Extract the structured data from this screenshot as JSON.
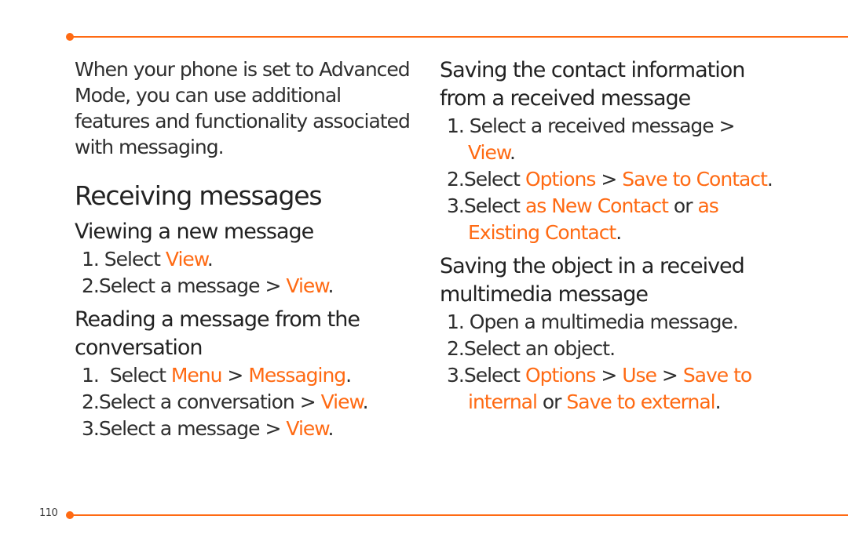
{
  "page": {
    "number": "110",
    "accent_color": "#ff6a13"
  },
  "left": {
    "intro": "When your phone is set to Advanced Mode, you can use additional features and functionality associated with messaging.",
    "heading": "Receiving messages",
    "sections": [
      {
        "title": "Viewing a new message",
        "steps": [
          {
            "num": "1.",
            "parts": [
              {
                "t": " Select "
              },
              {
                "t": "View",
                "hl": true
              },
              {
                "t": "."
              }
            ]
          },
          {
            "num": "2.",
            "parts": [
              {
                "t": "Select a message > "
              },
              {
                "t": "View",
                "hl": true
              },
              {
                "t": "."
              }
            ]
          }
        ]
      },
      {
        "title": "Reading a message from the conversation",
        "steps": [
          {
            "num": "1.",
            "parts": [
              {
                "t": "  Select "
              },
              {
                "t": "Menu",
                "hl": true
              },
              {
                "t": " > "
              },
              {
                "t": "Messaging",
                "hl": true
              },
              {
                "t": "."
              }
            ]
          },
          {
            "num": "2.",
            "parts": [
              {
                "t": "Select a conversation > "
              },
              {
                "t": "View",
                "hl": true
              },
              {
                "t": "."
              }
            ]
          },
          {
            "num": "3.",
            "parts": [
              {
                "t": "Select a message > "
              },
              {
                "t": "View",
                "hl": true
              },
              {
                "t": "."
              }
            ]
          }
        ]
      }
    ]
  },
  "right": {
    "sections": [
      {
        "title": "Saving the contact information from a received message",
        "steps": [
          {
            "num": "1.",
            "parts": [
              {
                "t": " Select a received message > "
              },
              {
                "t": "View",
                "hl": true
              },
              {
                "t": "."
              }
            ]
          },
          {
            "num": "2.",
            "parts": [
              {
                "t": "Select "
              },
              {
                "t": "Options",
                "hl": true
              },
              {
                "t": " > "
              },
              {
                "t": "Save to Contact",
                "hl": true
              },
              {
                "t": "."
              }
            ]
          },
          {
            "num": "3.",
            "parts": [
              {
                "t": "Select "
              },
              {
                "t": "as New Contact",
                "hl": true
              },
              {
                "t": " or "
              },
              {
                "t": "as Existing Contact",
                "hl": true
              },
              {
                "t": "."
              }
            ]
          }
        ]
      },
      {
        "title": "Saving the object in a received multimedia message",
        "steps": [
          {
            "num": "1.",
            "parts": [
              {
                "t": " Open a multimedia message."
              }
            ]
          },
          {
            "num": "2.",
            "parts": [
              {
                "t": "Select an object."
              }
            ]
          },
          {
            "num": "3.",
            "parts": [
              {
                "t": "Select "
              },
              {
                "t": "Options",
                "hl": true
              },
              {
                "t": " > "
              },
              {
                "t": "Use",
                "hl": true
              },
              {
                "t": " > "
              },
              {
                "t": "Save to internal",
                "hl": true
              },
              {
                "t": " or "
              },
              {
                "t": "Save to external",
                "hl": true
              },
              {
                "t": "."
              }
            ]
          }
        ]
      }
    ]
  }
}
